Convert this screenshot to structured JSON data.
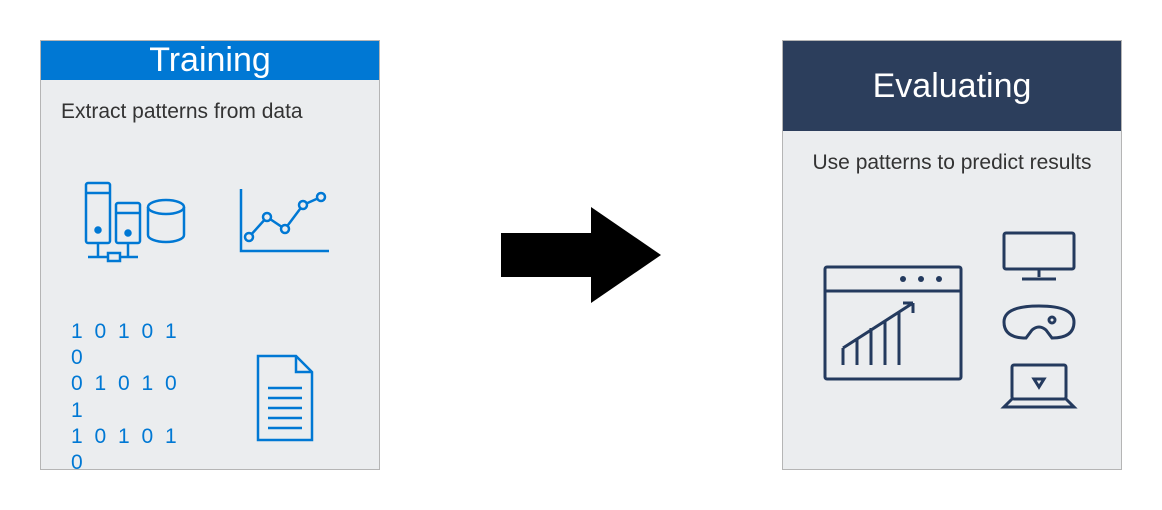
{
  "left_card": {
    "title": "Training",
    "description": "Extract patterns from data",
    "binary_lines": [
      "1 0 1 0 1 0",
      "0 1 0 1 0 1",
      "1 0 1 0 1 0"
    ]
  },
  "right_card": {
    "title": "Evaluating",
    "description": "Use patterns to predict results"
  },
  "colors": {
    "blue_accent": "#0078d4",
    "navy_accent": "#2c3e5c",
    "navy_stroke": "#243a5e"
  }
}
